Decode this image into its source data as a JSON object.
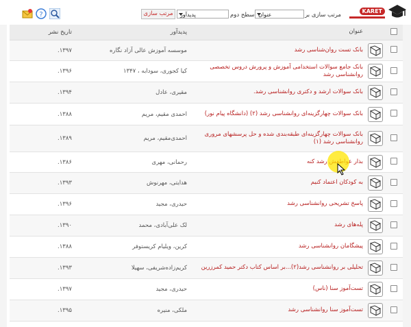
{
  "toolbar": {
    "logo_text": "KARET",
    "sort_by_label": "مرتب سازی بر اساس",
    "sort_by_value": "عنوان",
    "level_label": "سطح دوم",
    "level_value": "پدیدآور",
    "sort_button": "مرتب سازی",
    "icons": [
      "mail-icon",
      "help-icon",
      "search-icon"
    ]
  },
  "table": {
    "headers": {
      "title": "عنوان",
      "author": "پدیدآور",
      "date": "تاریخ نشر"
    },
    "rows": [
      {
        "title": "بانک تست روان‌شناسی رشد",
        "author": "موسسه آموزش عالی آزاد نگاره",
        "date": "۱۳۹۷."
      },
      {
        "title": "بانک جامع سوالات استخدامی آموزش و پرورش دروس تخصصی روانشناسی رشد",
        "author": "کیا کجوری، سودابه ، ۱۳۴۷",
        "date": "۱۳۹۶."
      },
      {
        "title": "بانک سوالات ارشد و دکتری روانشناسی رشد.",
        "author": "مقیری، عادل",
        "date": "۱۳۹۴."
      },
      {
        "title": "بانک سوالات چهارگزینه‌ای روانشناسی رشد (۲) (دانشگاه پیام نور)",
        "author": "احمدی مقیم، مریم",
        "date": "۱۳۸۸."
      },
      {
        "title": "بانک سوالات چهارگزینه‌ای طبقه‌بندی شده و حل پرسشهای مروری روانشناسی رشد (۱)",
        "author": "احمدی‌مقیم، مریم",
        "date": "۱۳۸۹."
      },
      {
        "title": "بذار عواطفش رشد کنه",
        "author": "رحمانی، مهری",
        "date": "۱۳۸۶."
      },
      {
        "title": "به کودکان اعتماد کنیم",
        "author": "هدایتی، مهرنوش",
        "date": "۱۳۹۳."
      },
      {
        "title": "پاسخ تشریحی روانشناسی رشد",
        "author": "حیدری، مجید",
        "date": "۱۳۹۶."
      },
      {
        "title": "پله‌های رشد",
        "author": "لک علی‌آبادی، محمد",
        "date": "۱۳۹۰."
      },
      {
        "title": "پیشگامان روانشناسی رشد",
        "author": "کرین، ویلیام کریستوفر",
        "date": "۱۳۸۸."
      },
      {
        "title": "تحلیلی بر روانشناسی رشد(۲)...بر اساس کتاب دکتر حمید کمرزرین",
        "author": "کریم‌زاده‌شریفی، سهیلا",
        "date": "۱۳۹۳."
      },
      {
        "title": "تست‌آموز سنا (ناس)",
        "author": "حیدری، مجید",
        "date": "۱۳۹۷."
      },
      {
        "title": "تست‌آموز سنا روانشناسی رشد",
        "author": "ملکی، منیره",
        "date": "۱۳۹۵."
      }
    ]
  },
  "colors": {
    "accent": "#b71c1c",
    "highlight": "#ffe600"
  }
}
